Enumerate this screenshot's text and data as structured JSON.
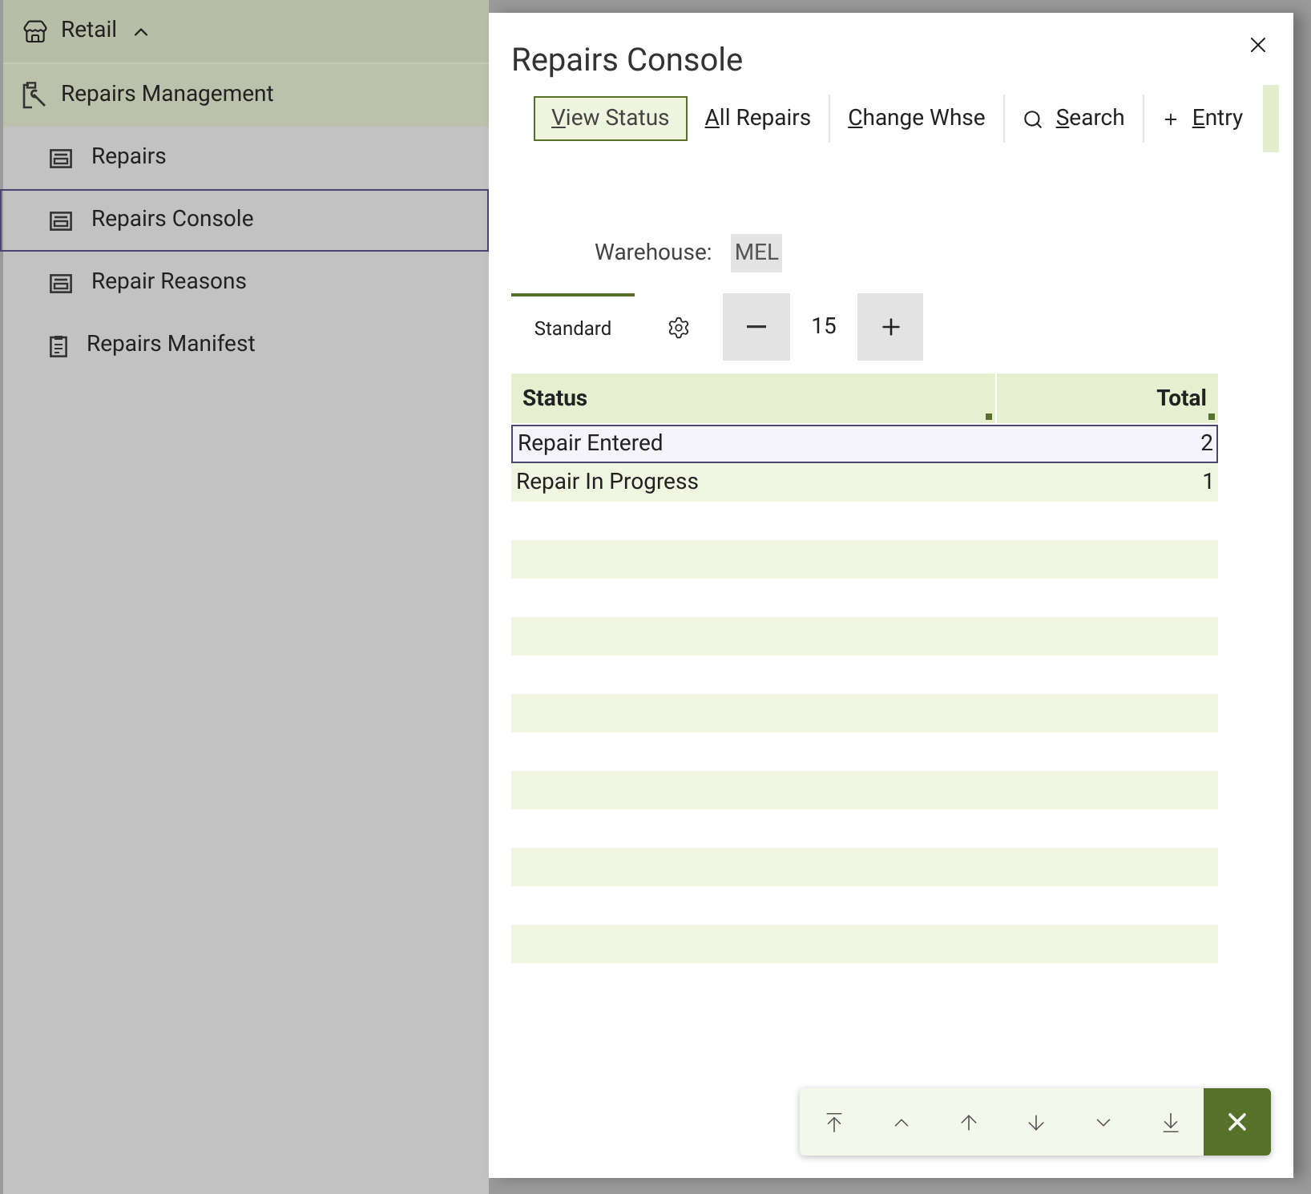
{
  "sidebar": {
    "group": {
      "label": "Retail",
      "expanded": true
    },
    "section": {
      "label": "Repairs Management"
    },
    "items": [
      {
        "label": "Repairs",
        "kind": "form",
        "selected": false
      },
      {
        "label": "Repairs Console",
        "kind": "form",
        "selected": true
      },
      {
        "label": "Repair Reasons",
        "kind": "form",
        "selected": false
      },
      {
        "label": "Repairs Manifest",
        "kind": "report",
        "selected": false
      }
    ]
  },
  "dialog": {
    "title": "Repairs Console",
    "toolbar": [
      {
        "label": "View Status",
        "kind": "plain",
        "selected": true
      },
      {
        "label": "All Repairs",
        "kind": "plain",
        "selected": false
      },
      {
        "label": "Change Whse",
        "kind": "plain",
        "selected": false
      },
      {
        "label": "Search",
        "kind": "search",
        "selected": false
      },
      {
        "label": "Entry",
        "kind": "add",
        "selected": false
      }
    ],
    "warehouse": {
      "label": "Warehouse:",
      "value": "MEL"
    },
    "view_tab": {
      "label": "Standard",
      "selected": true
    },
    "page_size": "15",
    "table": {
      "columns": [
        "Status",
        "Total"
      ],
      "rows": [
        {
          "status": "Repair Entered",
          "total": "2",
          "selected": true
        },
        {
          "status": "Repair In Progress",
          "total": "1",
          "selected": false
        }
      ]
    }
  }
}
